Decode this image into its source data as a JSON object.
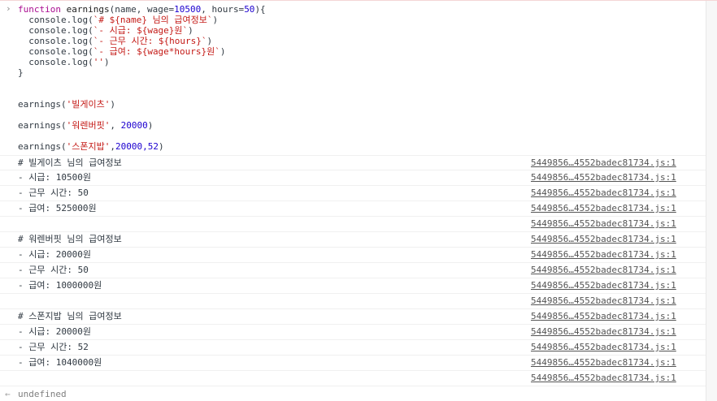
{
  "code": {
    "prompt_glyph": "›",
    "fn_line": {
      "kw": "function",
      "name": "earnings",
      "params_a": "(name, wage=",
      "wage_default": "10500",
      "params_b": ", hours=",
      "hours_default": "50",
      "params_c": "){"
    },
    "body": [
      {
        "pre": "  console.log(",
        "str": "`# ${name} 님의 급여정보`",
        "post": ")"
      },
      {
        "pre": "  console.log(",
        "str": "`- 시급: ${wage}원`",
        "post": ")"
      },
      {
        "pre": "  console.log(",
        "str": "`- 근무 시간: ${hours}`",
        "post": ")"
      },
      {
        "pre": "  console.log(",
        "str": "`- 급여: ${wage*hours}원`",
        "post": ")"
      },
      {
        "pre": "  console.log(",
        "str": "''",
        "post": ")"
      }
    ],
    "close": "}",
    "call1": {
      "pre": "earnings(",
      "str": "'빌게이츠'",
      "post": ")"
    },
    "call2": {
      "pre": "earnings(",
      "str": "'워렌버핏'",
      "mid": ", ",
      "num": "20000",
      "post": ")"
    },
    "call3": {
      "pre": "earnings(",
      "str": "'스폰지밥'",
      "mid": ",",
      "num": "20000,52",
      "post": ")"
    }
  },
  "logs": [
    {
      "msg": "# 빌게이츠 님의 급여정보",
      "src": "5449856…4552badec81734.js:1"
    },
    {
      "msg": "- 시급: 10500원",
      "src": "5449856…4552badec81734.js:1"
    },
    {
      "msg": "- 근무 시간: 50",
      "src": "5449856…4552badec81734.js:1"
    },
    {
      "msg": "- 급여: 525000원",
      "src": "5449856…4552badec81734.js:1"
    },
    {
      "msg": "",
      "src": "5449856…4552badec81734.js:1"
    },
    {
      "msg": "# 워렌버핏 님의 급여정보",
      "src": "5449856…4552badec81734.js:1"
    },
    {
      "msg": "- 시급: 20000원",
      "src": "5449856…4552badec81734.js:1"
    },
    {
      "msg": "- 근무 시간: 50",
      "src": "5449856…4552badec81734.js:1"
    },
    {
      "msg": "- 급여: 1000000원",
      "src": "5449856…4552badec81734.js:1"
    },
    {
      "msg": "",
      "src": "5449856…4552badec81734.js:1"
    },
    {
      "msg": "# 스폰지밥 님의 급여정보",
      "src": "5449856…4552badec81734.js:1"
    },
    {
      "msg": "- 시급: 20000원",
      "src": "5449856…4552badec81734.js:1"
    },
    {
      "msg": "- 근무 시간: 52",
      "src": "5449856…4552badec81734.js:1"
    },
    {
      "msg": "- 급여: 1040000원",
      "src": "5449856…4552badec81734.js:1"
    },
    {
      "msg": "",
      "src": "5449856…4552badec81734.js:1"
    }
  ],
  "result": {
    "glyph": "←",
    "text": "undefined"
  }
}
